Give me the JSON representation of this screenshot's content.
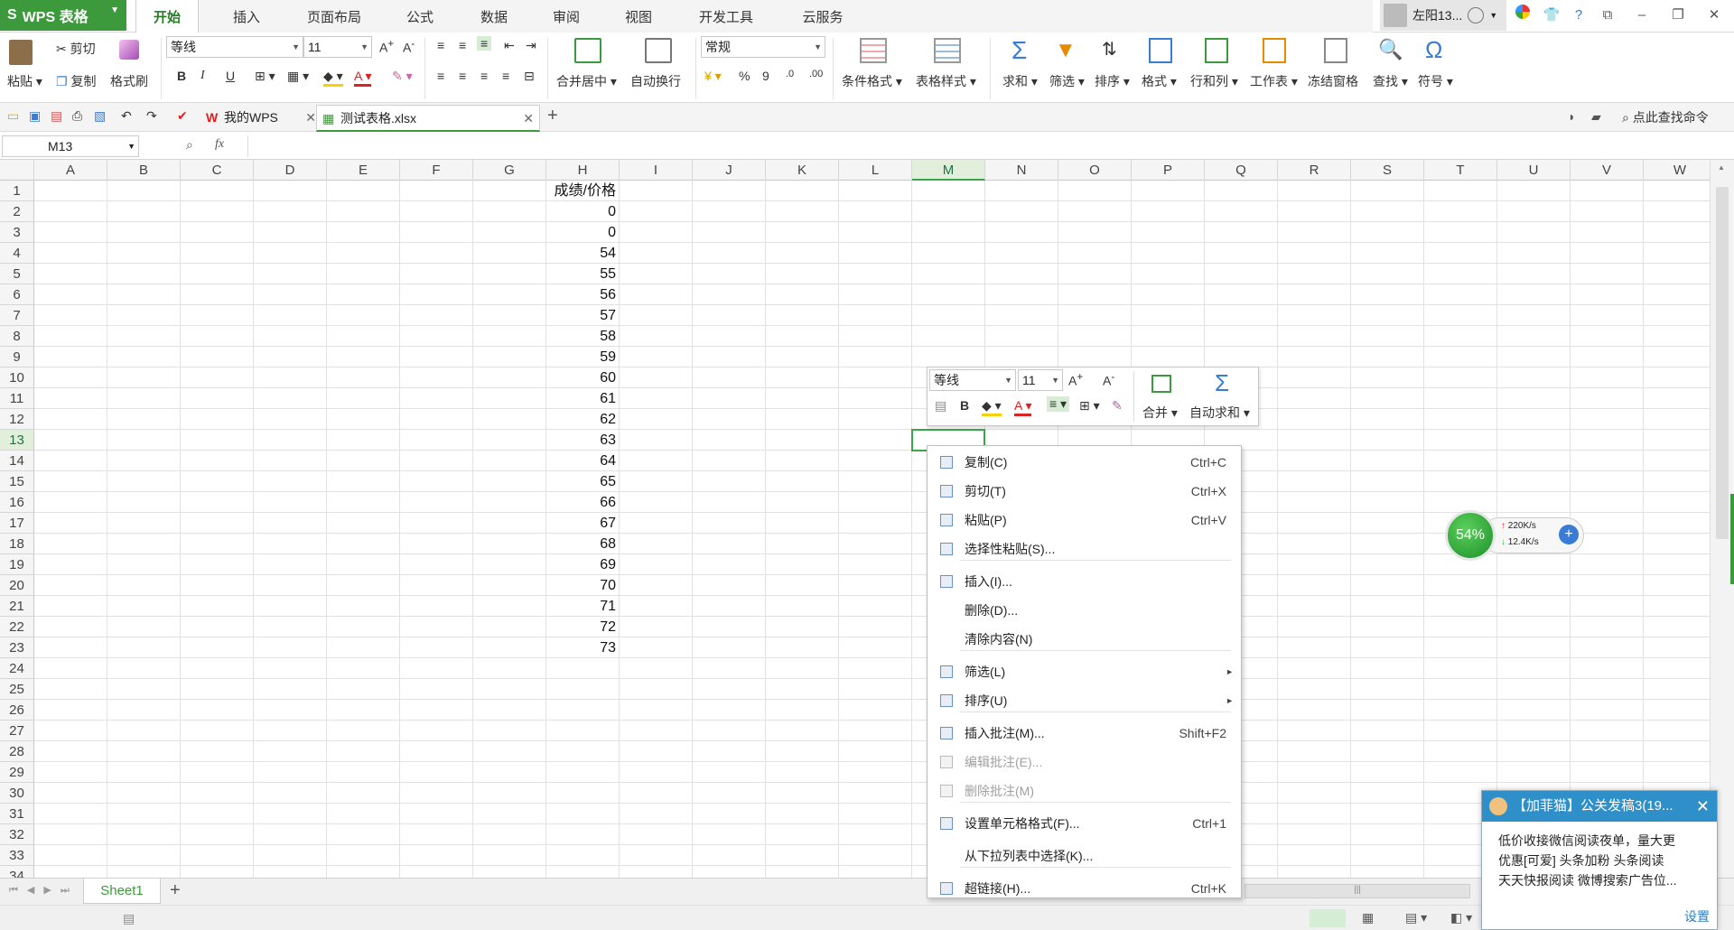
{
  "app": {
    "name": "WPS 表格",
    "logo": "S"
  },
  "menu_tabs": [
    "开始",
    "插入",
    "页面布局",
    "公式",
    "数据",
    "审阅",
    "视图",
    "开发工具",
    "云服务"
  ],
  "user": {
    "name": "左阳13..."
  },
  "ribbon": {
    "paste": "粘贴",
    "cut": "剪切",
    "copy": "复制",
    "format_painter": "格式刷",
    "font_name": "等线",
    "font_size": "11",
    "merge_center": "合并居中",
    "wrap_text": "自动换行",
    "number_format": "常规",
    "percent": "%",
    "thousands": "9",
    "cond_format": "条件格式",
    "table_style": "表格样式",
    "sum": "求和",
    "filter": "筛选",
    "sort": "排序",
    "format": "格式",
    "rows_cols": "行和列",
    "worksheet": "工作表",
    "freeze": "冻结窗格",
    "find": "查找",
    "symbol": "符号"
  },
  "doc_tabs": [
    {
      "label": "我的WPS"
    },
    {
      "label": "测试表格.xlsx"
    }
  ],
  "find_command": "点此查找命令",
  "formula_bar": {
    "name_box": "M13",
    "fx": "fx",
    "formula": ""
  },
  "columns": [
    "A",
    "B",
    "C",
    "D",
    "E",
    "F",
    "G",
    "H",
    "I",
    "J",
    "K",
    "L",
    "M",
    "N",
    "O",
    "P",
    "Q",
    "R",
    "S",
    "T",
    "U",
    "V",
    "W"
  ],
  "selected_column": "M",
  "selected_row": "13",
  "rows": [
    "1",
    "2",
    "3",
    "4",
    "5",
    "6",
    "7",
    "8",
    "9",
    "10",
    "11",
    "12",
    "13",
    "14",
    "15",
    "16",
    "17",
    "18",
    "19",
    "20",
    "21",
    "22",
    "23",
    "24",
    "25",
    "26",
    "27",
    "28",
    "29",
    "30",
    "31",
    "32",
    "33",
    "34"
  ],
  "column_h": {
    "header": "成绩/价格",
    "values": [
      "0",
      "0",
      "54",
      "55",
      "56",
      "57",
      "58",
      "59",
      "60",
      "61",
      "62",
      "63",
      "64",
      "65",
      "66",
      "67",
      "68",
      "69",
      "70",
      "71",
      "72",
      "73"
    ]
  },
  "mini_toolbar": {
    "font": "等线",
    "size": "11",
    "bold": "B",
    "merge": "合并",
    "autosum": "自动求和"
  },
  "context_menu": [
    {
      "label": "复制(C)",
      "shortcut": "Ctrl+C",
      "enabled": true,
      "icon": "copy-icon"
    },
    {
      "label": "剪切(T)",
      "shortcut": "Ctrl+X",
      "enabled": true,
      "icon": "scissors-icon"
    },
    {
      "label": "粘贴(P)",
      "shortcut": "Ctrl+V",
      "enabled": true,
      "icon": "paste-icon"
    },
    {
      "label": "选择性粘贴(S)...",
      "shortcut": "",
      "enabled": true,
      "icon": "paste-special-icon"
    },
    {
      "label": "插入(I)...",
      "shortcut": "",
      "enabled": true,
      "icon": "insert-icon"
    },
    {
      "label": "删除(D)...",
      "shortcut": "",
      "enabled": true,
      "icon": ""
    },
    {
      "label": "清除内容(N)",
      "shortcut": "",
      "enabled": true,
      "icon": ""
    },
    {
      "label": "筛选(L)",
      "shortcut": "",
      "enabled": true,
      "icon": "filter-icon",
      "submenu": true
    },
    {
      "label": "排序(U)",
      "shortcut": "",
      "enabled": true,
      "icon": "sort-icon",
      "submenu": true
    },
    {
      "label": "插入批注(M)...",
      "shortcut": "Shift+F2",
      "enabled": true,
      "icon": "comment-icon"
    },
    {
      "label": "编辑批注(E)...",
      "shortcut": "",
      "enabled": false,
      "icon": "edit-comment-icon"
    },
    {
      "label": "删除批注(M)",
      "shortcut": "",
      "enabled": false,
      "icon": "delete-comment-icon"
    },
    {
      "label": "设置单元格格式(F)...",
      "shortcut": "Ctrl+1",
      "enabled": true,
      "icon": "format-cells-icon"
    },
    {
      "label": "从下拉列表中选择(K)...",
      "shortcut": "",
      "enabled": true,
      "icon": ""
    },
    {
      "label": "超链接(H)...",
      "shortcut": "Ctrl+K",
      "enabled": true,
      "icon": "hyperlink-icon"
    }
  ],
  "sheet_tabs": [
    "Sheet1"
  ],
  "net_widget": {
    "percent": "54%",
    "upload": "220K/s",
    "download": "12.4K/s"
  },
  "notification": {
    "title": "【加菲猫】公关发稿3(19...",
    "lines": [
      "低价收接微信阅读夜单，量大更",
      "优惠[可爱] 头条加粉 头条阅读",
      "天天快报阅读  微博搜索广告位..."
    ],
    "settings": "设置"
  },
  "colors": {
    "accent": "#3c9a3c",
    "selection": "#3aa64a",
    "notif_header": "#2f8fc9"
  }
}
